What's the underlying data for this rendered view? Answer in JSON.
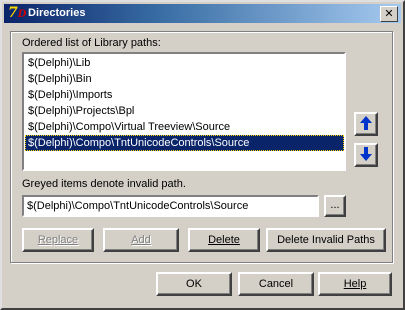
{
  "window": {
    "title": "Directories",
    "close_glyph": "✕"
  },
  "list": {
    "label": "Ordered list of Library paths:",
    "items": [
      "$(Delphi)\\Lib",
      "$(Delphi)\\Bin",
      "$(Delphi)\\Imports",
      "$(Delphi)\\Projects\\Bpl",
      "$(Delphi)\\Compo\\Virtual Treeview\\Source",
      "$(Delphi)\\Compo\\TntUnicodeControls\\Source"
    ],
    "selected_index": 5
  },
  "hint": "Greyed items denote invalid path.",
  "path_input": {
    "value": "$(Delphi)\\Compo\\TntUnicodeControls\\Source",
    "browse_label": "..."
  },
  "buttons": {
    "replace": "Replace",
    "add": "Add",
    "delete": "Delete",
    "delete_invalid": "Delete Invalid Paths",
    "ok": "OK",
    "cancel": "Cancel",
    "help": "Help"
  },
  "colors": {
    "accent": "#0a246a",
    "arrow": "#0033cc",
    "face": "#d4d0c8"
  }
}
